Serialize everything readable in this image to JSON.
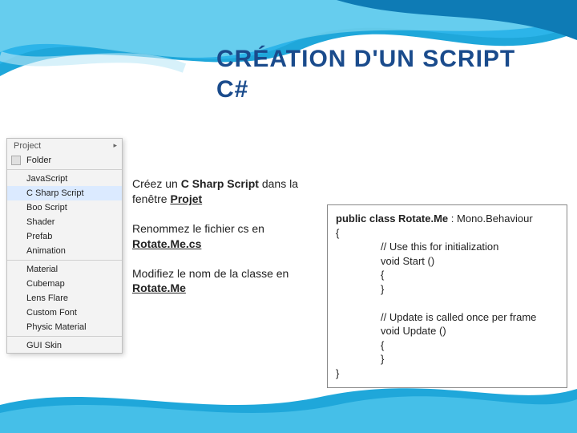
{
  "title_line1": "CRÉATION D'UN SCRIPT",
  "title_line2": "C#",
  "menu": {
    "header": "Project",
    "items": [
      {
        "label": "Folder",
        "icon": true
      },
      {
        "label": "JavaScript",
        "sep_before": true
      },
      {
        "label": "C Sharp Script",
        "active": true
      },
      {
        "label": "Boo Script"
      },
      {
        "label": "Shader"
      },
      {
        "label": "Prefab"
      },
      {
        "label": "Animation"
      },
      {
        "label": "Material",
        "sep_before": true
      },
      {
        "label": "Cubemap"
      },
      {
        "label": "Lens Flare"
      },
      {
        "label": "Custom Font"
      },
      {
        "label": "Physic Material"
      },
      {
        "label": "GUI Skin",
        "sep_before": true
      }
    ]
  },
  "steps": {
    "s1a": "Créez un ",
    "s1b": "C Sharp Script",
    "s1c": " dans la fenêtre ",
    "s1d": "Projet",
    "s2a": "Renommez le fichier cs en ",
    "s2b": "Rotate.Me.cs",
    "s3a": "Modifiez le nom de la classe en ",
    "s3b": "Rotate.Me"
  },
  "code": {
    "l1a": "public class ",
    "l1b": "Rotate.Me",
    "l1c": " : Mono.Behaviour",
    "l2": "{",
    "l3": "// Use this for initialization",
    "l4": "void Start ()",
    "l5": "{",
    "l6": "}",
    "l7": "// Update is called once per frame",
    "l8": "void Update ()",
    "l9": "{",
    "l10": "}",
    "l11": "}"
  }
}
